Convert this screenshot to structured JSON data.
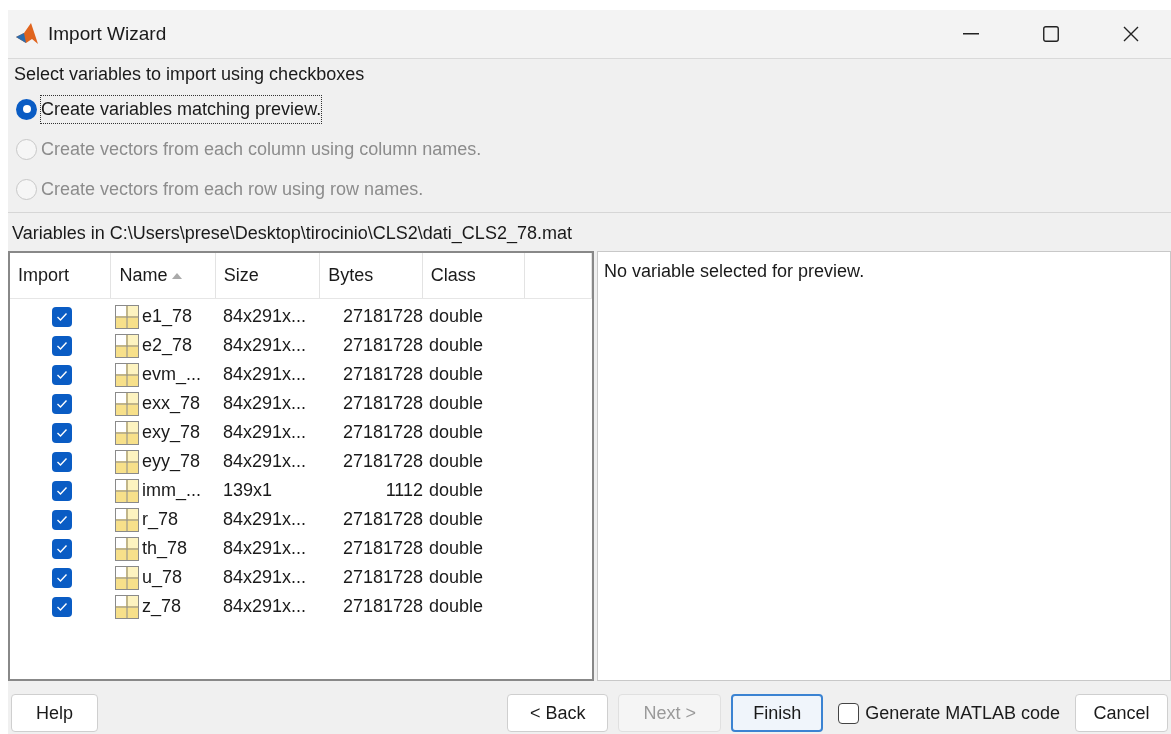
{
  "window": {
    "title": "Import Wizard"
  },
  "instruction": "Select variables to import using checkboxes",
  "options": [
    {
      "label": "Create variables matching preview.",
      "selected": true,
      "disabled": false
    },
    {
      "label": "Create vectors from each column using column names.",
      "selected": false,
      "disabled": true
    },
    {
      "label": "Create vectors from each row using row names.",
      "selected": false,
      "disabled": true
    }
  ],
  "path_label": "Variables in C:\\Users\\prese\\Desktop\\tirocinio\\CLS2\\dati_CLS2_78.mat",
  "table": {
    "columns": [
      {
        "label": "Import",
        "sorted": false
      },
      {
        "label": "Name",
        "sorted": true
      },
      {
        "label": "Size",
        "sorted": false
      },
      {
        "label": "Bytes",
        "sorted": false
      },
      {
        "label": "Class",
        "sorted": false
      }
    ],
    "rows": [
      {
        "checked": true,
        "name": "e1_78",
        "size": "84x291x...",
        "bytes": "27181728",
        "class": "double"
      },
      {
        "checked": true,
        "name": "e2_78",
        "size": "84x291x...",
        "bytes": "27181728",
        "class": "double"
      },
      {
        "checked": true,
        "name": "evm_...",
        "size": "84x291x...",
        "bytes": "27181728",
        "class": "double"
      },
      {
        "checked": true,
        "name": "exx_78",
        "size": "84x291x...",
        "bytes": "27181728",
        "class": "double"
      },
      {
        "checked": true,
        "name": "exy_78",
        "size": "84x291x...",
        "bytes": "27181728",
        "class": "double"
      },
      {
        "checked": true,
        "name": "eyy_78",
        "size": "84x291x...",
        "bytes": "27181728",
        "class": "double"
      },
      {
        "checked": true,
        "name": "imm_...",
        "size": "139x1",
        "bytes": "1112",
        "class": "double"
      },
      {
        "checked": true,
        "name": "r_78",
        "size": "84x291x...",
        "bytes": "27181728",
        "class": "double"
      },
      {
        "checked": true,
        "name": "th_78",
        "size": "84x291x...",
        "bytes": "27181728",
        "class": "double"
      },
      {
        "checked": true,
        "name": "u_78",
        "size": "84x291x...",
        "bytes": "27181728",
        "class": "double"
      },
      {
        "checked": true,
        "name": "z_78",
        "size": "84x291x...",
        "bytes": "27181728",
        "class": "double"
      }
    ]
  },
  "preview": {
    "message": "No variable selected for preview."
  },
  "help_button": {
    "label": "Help"
  },
  "nav_buttons": [
    {
      "label": "< Back",
      "disabled": false,
      "focused": false
    },
    {
      "label": "Next >",
      "disabled": true,
      "focused": false
    },
    {
      "label": "Finish",
      "disabled": false,
      "focused": true
    }
  ],
  "generate_code": {
    "label": "Generate MATLAB code",
    "checked": false
  },
  "cancel_button": {
    "label": "Cancel"
  }
}
